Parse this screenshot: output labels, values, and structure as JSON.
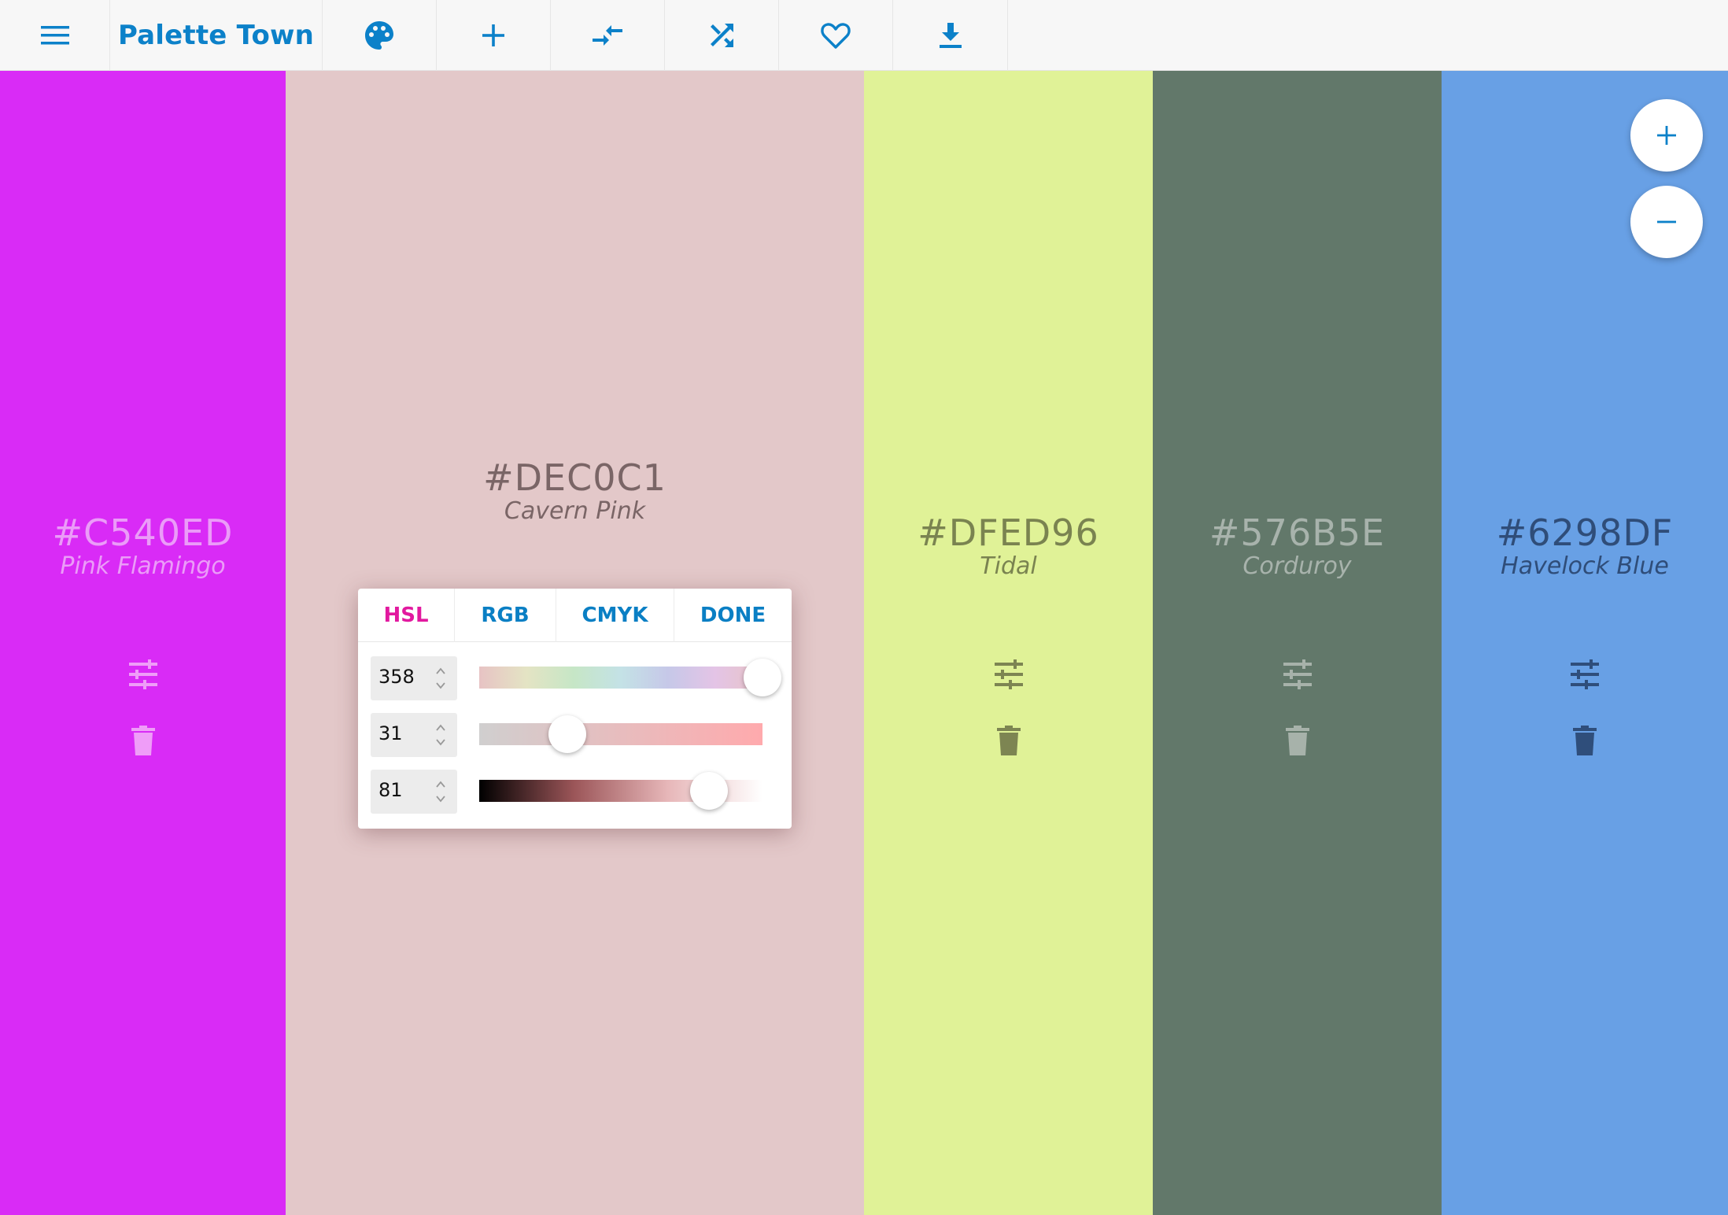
{
  "app": {
    "brand": "Palette Town"
  },
  "toolbar": {
    "icons": [
      "menu-icon",
      "palette-icon",
      "plus-icon",
      "compress-icon",
      "shuffle-icon",
      "heart-icon",
      "download-icon"
    ],
    "accent": "#0c81c9"
  },
  "swatches": [
    {
      "hex": "#C540ED",
      "name": "Pink Flamingo",
      "bg": "#d92bf6",
      "text": "#eb9cf8"
    },
    {
      "hex": "#DEC0C1",
      "name": "Cavern Pink",
      "bg": "#e3c8c9",
      "text": "#7a6566"
    },
    {
      "hex": "#DFED96",
      "name": "Tidal",
      "bg": "#e0f297",
      "text": "#7a8350"
    },
    {
      "hex": "#576B5E",
      "name": "Corduroy",
      "bg": "#62786a",
      "text": "#a8b3ac"
    },
    {
      "hex": "#6298DF",
      "name": "Havelock Blue",
      "bg": "#68a0e5",
      "text": "#2f4d79"
    }
  ],
  "picker": {
    "tabs": [
      "HSL",
      "RGB",
      "CMYK",
      "DONE"
    ],
    "active_tab": "HSL",
    "active_color": "#e2199f",
    "fields": [
      {
        "label": "hue",
        "value": "358",
        "fraction": 1.0
      },
      {
        "label": "saturation",
        "value": "31",
        "fraction": 0.31
      },
      {
        "label": "lightness",
        "value": "81",
        "fraction": 0.81
      }
    ]
  },
  "zoom": {
    "in_icon": "plus-icon",
    "out_icon": "minus-icon"
  }
}
